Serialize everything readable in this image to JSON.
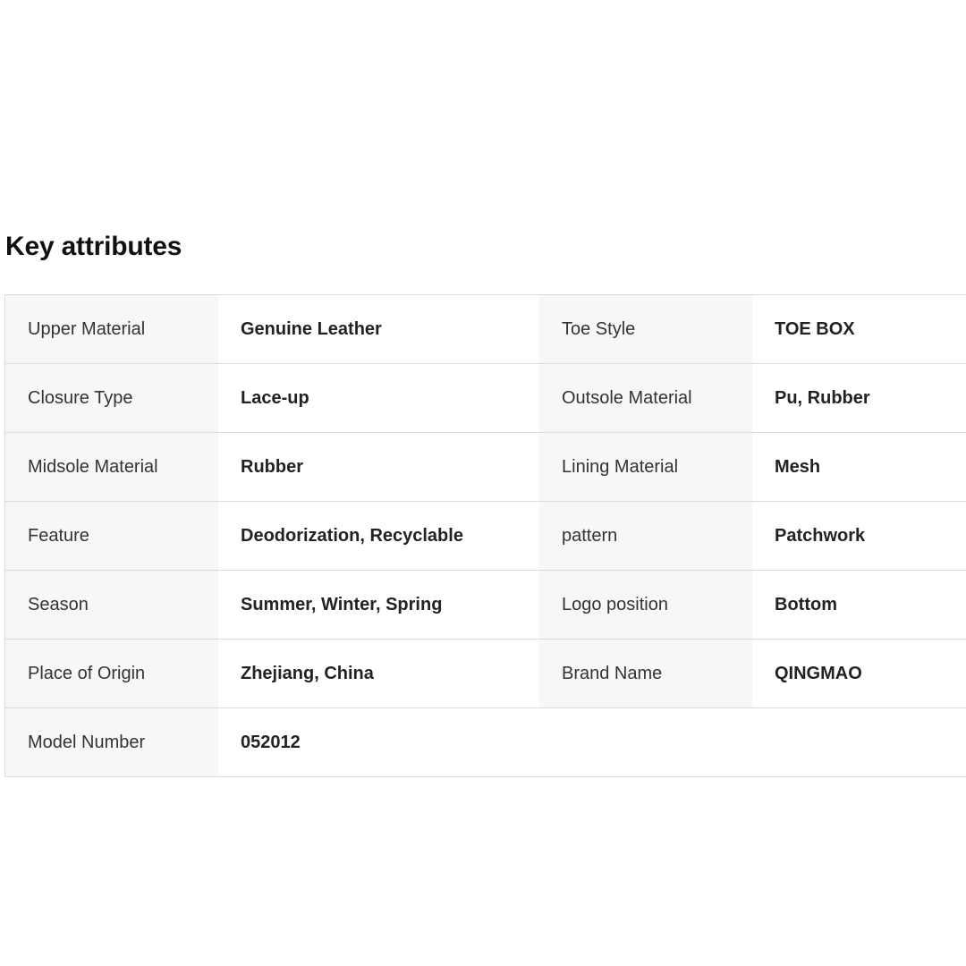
{
  "section": {
    "title": "Key attributes"
  },
  "rows": [
    {
      "left_label": "Upper Material",
      "left_value": "Genuine Leather",
      "right_label": "Toe Style",
      "right_value": "TOE BOX"
    },
    {
      "left_label": "Closure Type",
      "left_value": "Lace-up",
      "right_label": "Outsole Material",
      "right_value": "Pu, Rubber"
    },
    {
      "left_label": "Midsole Material",
      "left_value": "Rubber",
      "right_label": "Lining Material",
      "right_value": "Mesh"
    },
    {
      "left_label": "Feature",
      "left_value": "Deodorization, Recyclable",
      "right_label": "pattern",
      "right_value": "Patchwork"
    },
    {
      "left_label": "Season",
      "left_value": "Summer, Winter, Spring",
      "right_label": "Logo position",
      "right_value": "Bottom"
    },
    {
      "left_label": "Place of Origin",
      "left_value": "Zhejiang, China",
      "right_label": "Brand Name",
      "right_value": "QINGMAO"
    },
    {
      "left_label": "Model Number",
      "left_value": "052012"
    }
  ],
  "colors": {
    "label_bg": "#f7f7f7",
    "border": "#dcdcdc",
    "text": "#222222"
  }
}
